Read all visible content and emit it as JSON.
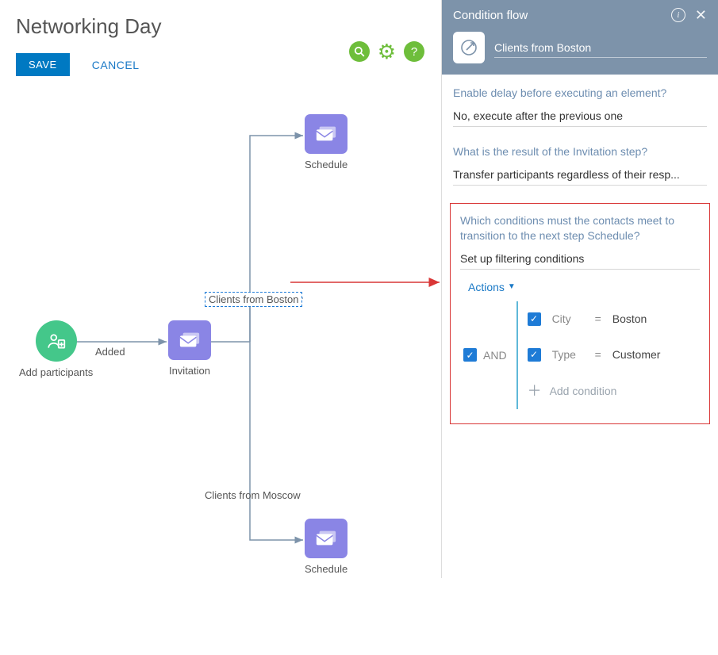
{
  "page": {
    "title": "Networking Day",
    "save_label": "SAVE",
    "cancel_label": "CANCEL"
  },
  "flow": {
    "nodes": {
      "add_participants": "Add participants",
      "invitation": "Invitation",
      "schedule_top": "Schedule",
      "schedule_bottom": "Schedule"
    },
    "edges": {
      "added": "Added",
      "boston": "Clients from Boston",
      "moscow": "Clients from Moscow"
    }
  },
  "panel": {
    "title": "Condition flow",
    "flow_name": "Clients from Boston",
    "fields": {
      "delay_label": "Enable delay before executing an element?",
      "delay_value": "No, execute after the previous one",
      "result_label": "What is the result of the Invitation step?",
      "result_value": "Transfer participants regardless of their resp...",
      "cond_label": "Which conditions must the contacts meet to transition to the next step Schedule?",
      "cond_value": "Set up filtering conditions"
    },
    "actions_label": "Actions",
    "logic_op": "AND",
    "conditions": [
      {
        "field": "City",
        "op": "=",
        "value": "Boston"
      },
      {
        "field": "Type",
        "op": "=",
        "value": "Customer"
      }
    ],
    "add_condition_label": "Add condition"
  }
}
